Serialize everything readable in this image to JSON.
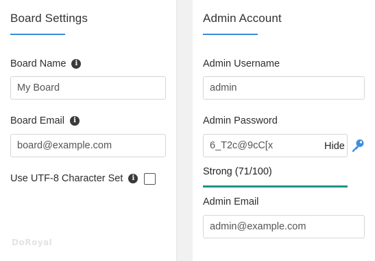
{
  "board_settings": {
    "title": "Board Settings",
    "board_name": {
      "label": "Board Name",
      "value": "My Board"
    },
    "board_email": {
      "label": "Board Email",
      "value": "board@example.com"
    },
    "utf8": {
      "label": "Use UTF-8 Character Set",
      "checked": false
    },
    "watermark": "DoRoyal"
  },
  "admin_account": {
    "title": "Admin Account",
    "username": {
      "label": "Admin Username",
      "value": "admin"
    },
    "password": {
      "label": "Admin Password",
      "value": "6_T2c@9cC[x",
      "hide_label": "Hide",
      "strength_text": "Strong (71/100)",
      "strength_score": 71
    },
    "email": {
      "label": "Admin Email",
      "value": "admin@example.com"
    }
  },
  "colors": {
    "accent": "#3b8bd9",
    "strength": "#1b9484",
    "key_icon": "#3d8fdb"
  }
}
